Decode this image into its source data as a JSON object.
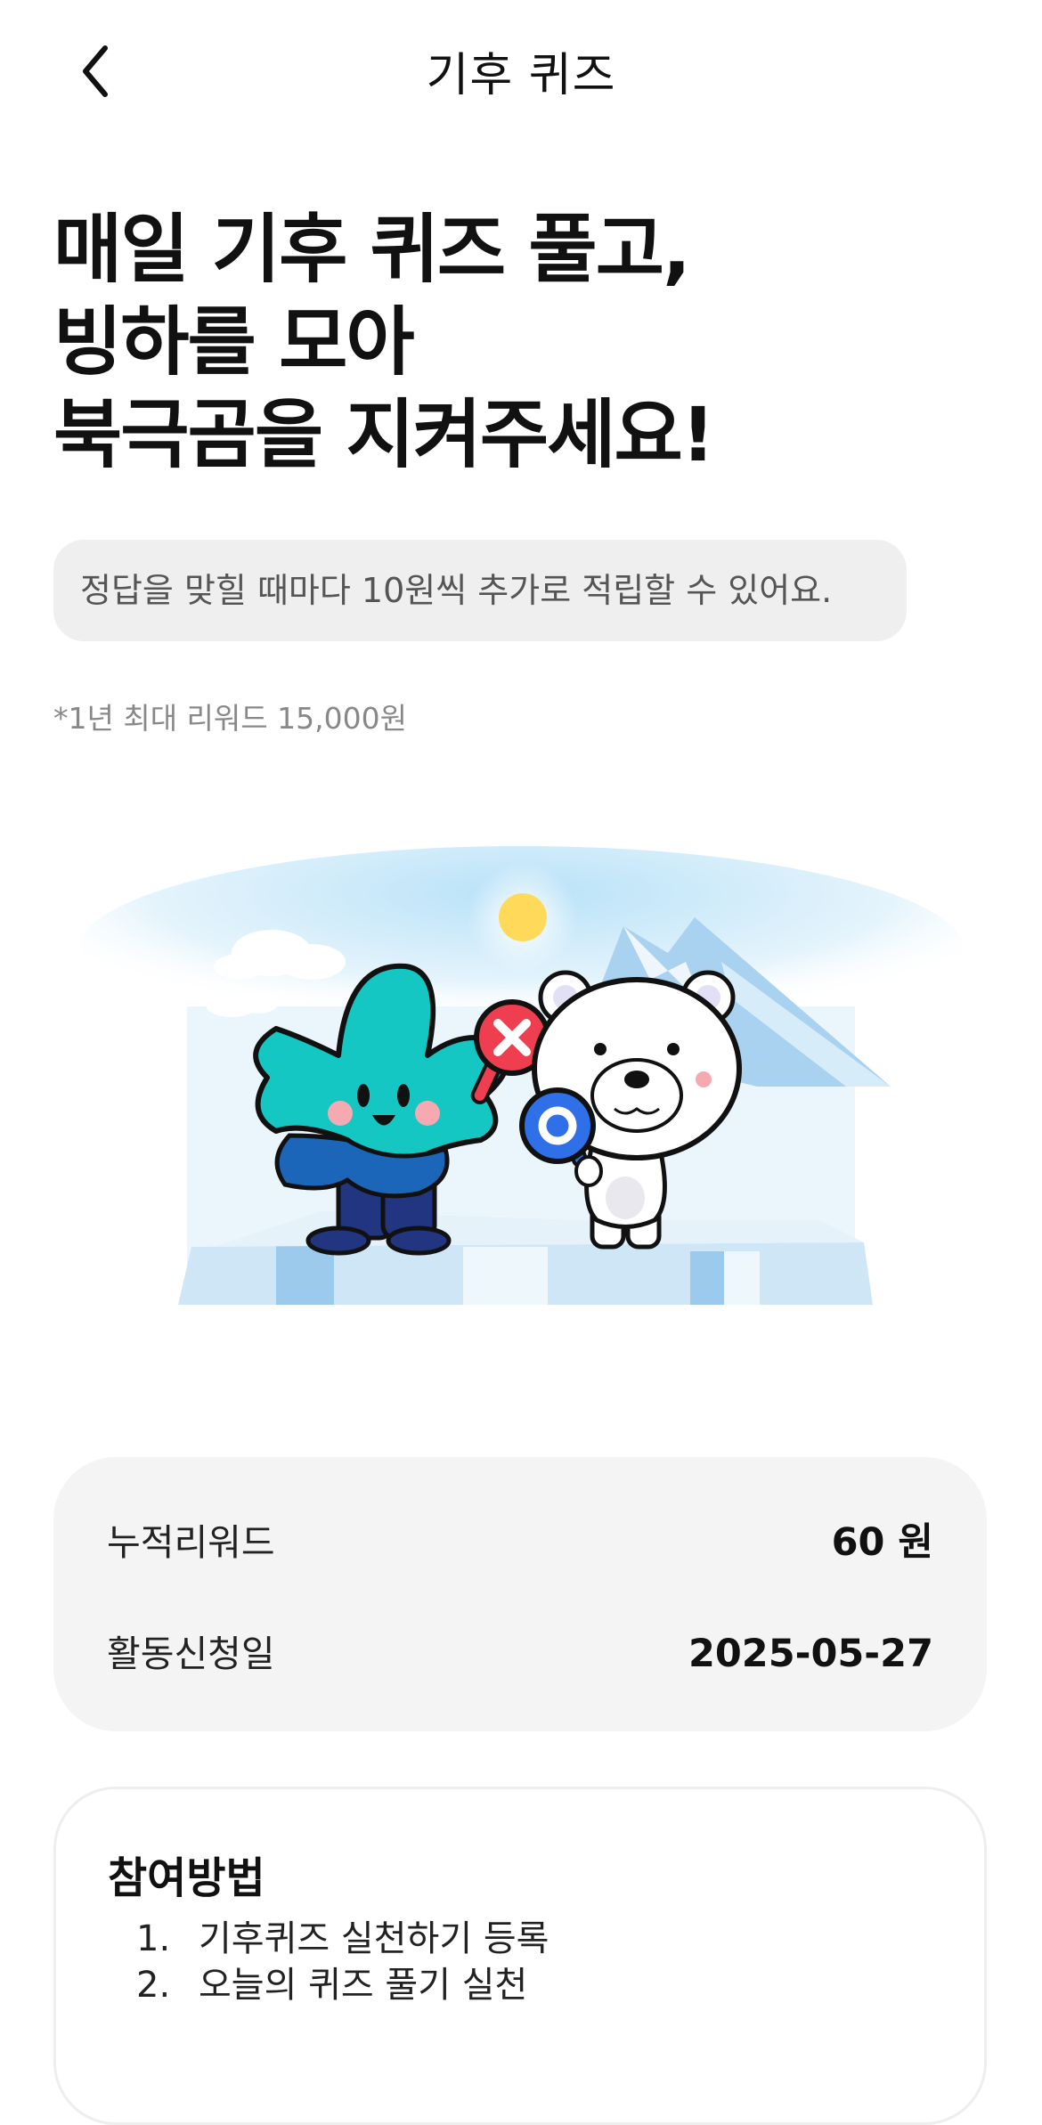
{
  "header": {
    "title": "기후 퀴즈"
  },
  "hero": {
    "headline_lines": [
      "매일 기후 퀴즈 풀고,",
      "빙하를 모아",
      "북극곰을 지켜주세요!"
    ],
    "info_text": "정답을 맞힐 때마다 10원씩 추가로 적립할 수 있어요.",
    "note": "*1년 최대 리워드 15,000원"
  },
  "summary": {
    "rows": [
      {
        "label": "누적리워드",
        "value": "60 원"
      },
      {
        "label": "활동신청일",
        "value": "2025-05-27"
      }
    ]
  },
  "howto": {
    "title": "참여방법",
    "steps": [
      {
        "num": "1.",
        "text": "기후퀴즈 실천하기 등록"
      },
      {
        "num": "2.",
        "text": "오늘의 퀴즈 풀기 실천"
      }
    ]
  },
  "colors": {
    "quiz_x_red": "#ef3e4f",
    "quiz_o_blue": "#2f6fe8",
    "mascot_teal": "#15c7c3",
    "mascot_navy": "#213580",
    "ice_blue": "#cde8f7",
    "sun_yellow": "#ffd95a"
  },
  "icons": {
    "back": "chevron-left-icon"
  }
}
